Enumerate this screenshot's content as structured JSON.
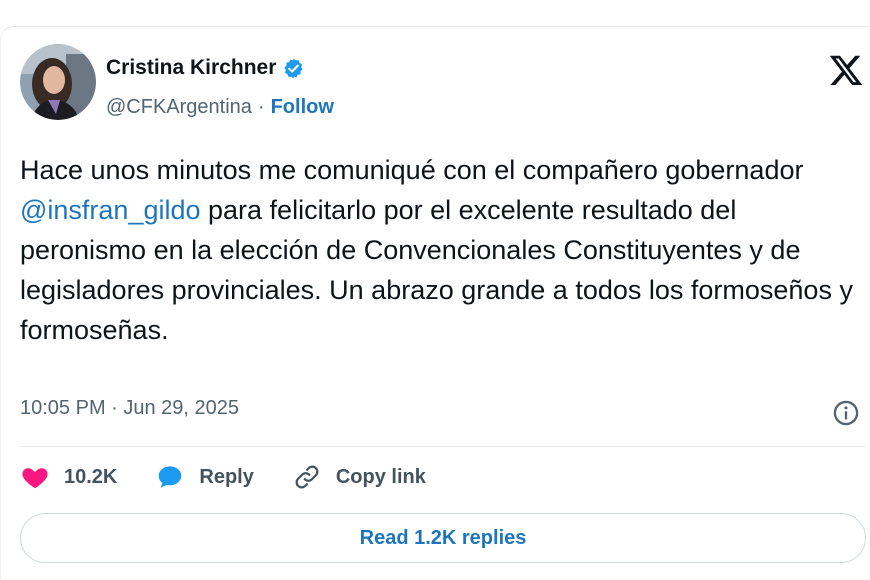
{
  "author": {
    "name": "Cristina Kirchner",
    "handle": "@CFKArgentina",
    "separator": "·",
    "follow_label": "Follow",
    "verified": true
  },
  "tweet": {
    "text_before": "Hace unos minutos me comuniqué con el compañero gobernador ",
    "mention": "@insfran_gildo",
    "text_after": " para felicitarlo por el excelente resultado del peronismo en la elección de Convencionales Constituyentes y de legisladores provinciales. Un abrazo grande a todos los formoseños y formoseñas."
  },
  "meta": {
    "timestamp": "10:05 PM · Jun 29, 2025"
  },
  "actions": {
    "likes_count": "10.2K",
    "reply_label": "Reply",
    "copy_link_label": "Copy link"
  },
  "footer": {
    "read_replies_label": "Read 1.2K replies"
  },
  "colors": {
    "accent": "#1d76bd",
    "like": "#f91880",
    "text": "#0f1419",
    "muted": "#536471"
  },
  "icons": {
    "verified": "verified-badge-icon",
    "platform": "x-logo-icon",
    "info": "info-icon",
    "like": "heart-icon",
    "reply": "speech-bubble-icon",
    "copy_link": "link-icon"
  }
}
